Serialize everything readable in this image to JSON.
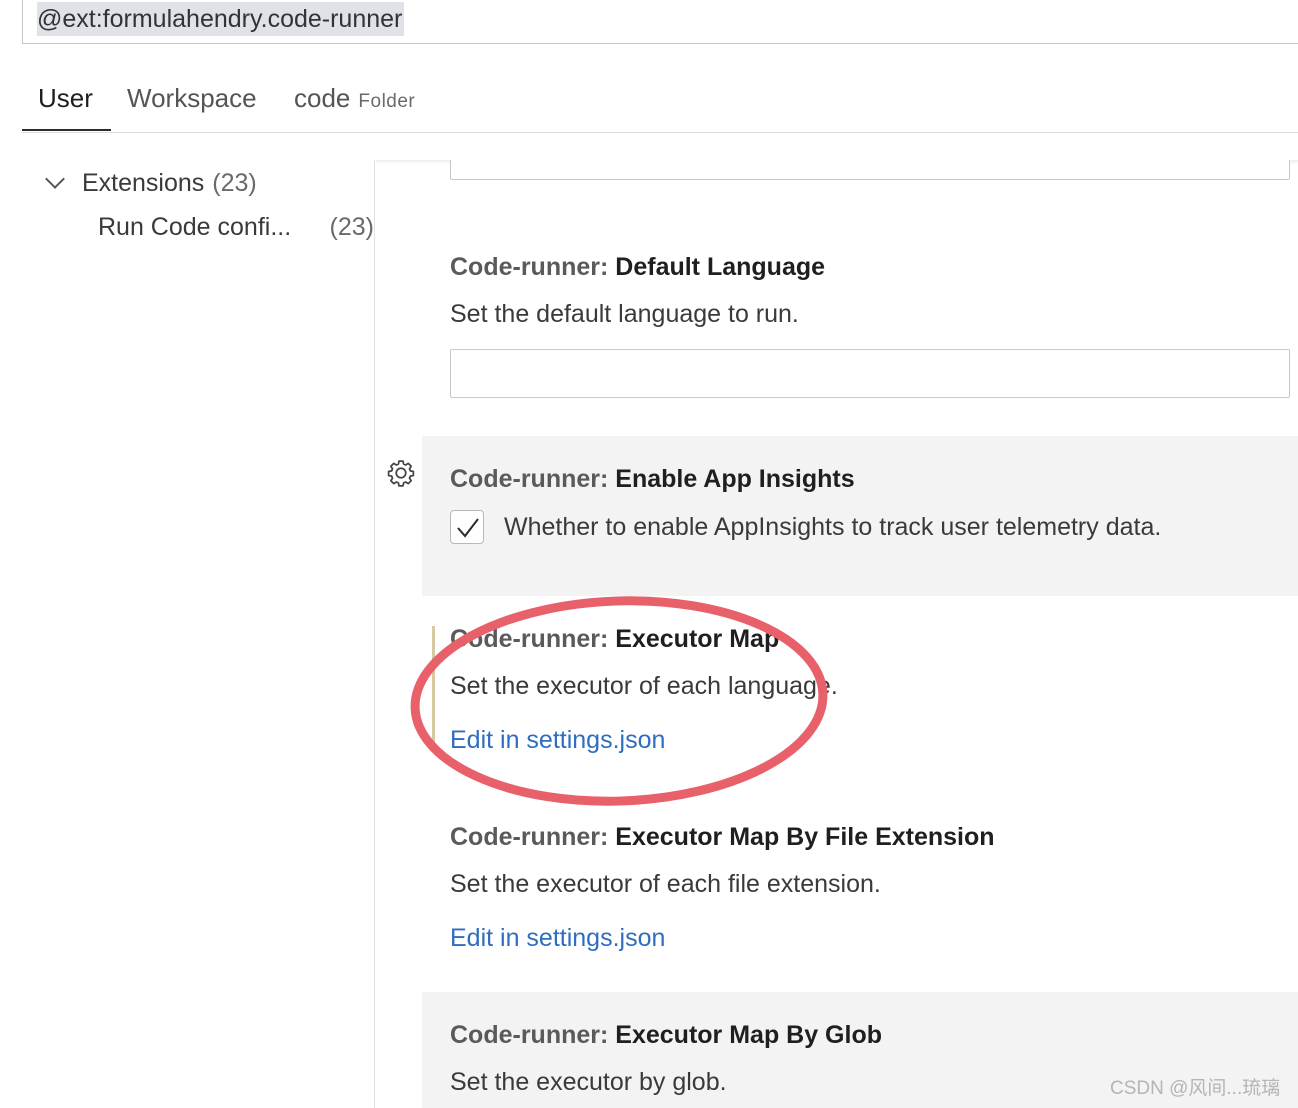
{
  "search": {
    "value": "@ext:formulahendry.code-runner"
  },
  "tabs": [
    {
      "label": "User",
      "active": true
    },
    {
      "label": "Workspace",
      "active": false
    },
    {
      "label": "code",
      "sublabel": "Folder",
      "active": false
    }
  ],
  "toc": {
    "group_label": "Extensions",
    "group_count": "(23)",
    "item_label": "Run Code confi...",
    "item_count": "(23)"
  },
  "settings": [
    {
      "category": "Code-runner:",
      "name": "Default Language",
      "description": "Set the default language to run.",
      "control": "text",
      "value": ""
    },
    {
      "category": "Code-runner:",
      "name": "Enable App Insights",
      "description": "Whether to enable AppInsights to track user telemetry data.",
      "control": "checkbox",
      "checked": true,
      "icon": "gear-icon"
    },
    {
      "category": "Code-runner:",
      "name": "Executor Map",
      "description": "Set the executor of each language.",
      "link": "Edit in settings.json"
    },
    {
      "category": "Code-runner:",
      "name": "Executor Map By File Extension",
      "description": "Set the executor of each file extension.",
      "link": "Edit in settings.json"
    },
    {
      "category": "Code-runner:",
      "name": "Executor Map By Glob",
      "description": "Set the executor by glob."
    }
  ],
  "annotation": {
    "color": "#e8606a"
  },
  "watermark": "CSDN @风间...琉璃",
  "colors": {
    "link": "#2f6dc0",
    "highlight_bg": "#f3f3f3",
    "modified_bar": "#d9c9a3"
  }
}
